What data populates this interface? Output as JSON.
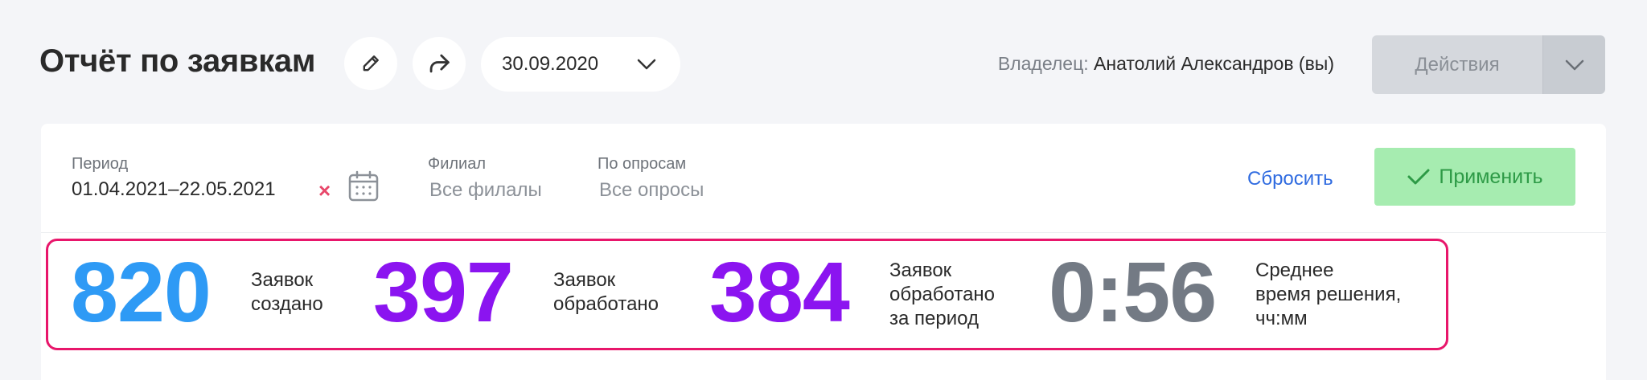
{
  "header": {
    "title": "Отчёт по заявкам",
    "date": "30.09.2020",
    "owner_label": "Владелец:",
    "owner_name": "Анатолий Александров (вы)",
    "actions_label": "Действия"
  },
  "filters": {
    "period_label": "Период",
    "period_value": "01.04.2021–22.05.2021",
    "clear_symbol": "×",
    "branch_label": "Филиал",
    "branch_value": "Все филалы",
    "survey_label": "По опросам",
    "survey_value": "Все опросы",
    "reset_label": "Сбросить",
    "apply_label": "Применить"
  },
  "stats": [
    {
      "value": "820",
      "label_line1": "Заявок",
      "label_line2": "создано",
      "label_line3": "",
      "color": "#2e9af5"
    },
    {
      "value": "397",
      "label_line1": "Заявок",
      "label_line2": "обработано",
      "label_line3": "",
      "color": "#8b14f0"
    },
    {
      "value": "384",
      "label_line1": "Заявок",
      "label_line2": "обработано",
      "label_line3": "за период",
      "color": "#8b14f0"
    },
    {
      "value": "0:56",
      "label_line1": "Среднее",
      "label_line2": "время решения,",
      "label_line3": "чч:мм",
      "color": "#737a84"
    }
  ],
  "colors": {
    "accent_link": "#2f6be0",
    "apply_bg": "#a6ecb0",
    "apply_text": "#2d9a46",
    "highlight_border": "#e8166b",
    "clear_x": "#e8476a"
  },
  "icons": {
    "edit": "pencil-icon",
    "share": "share-icon",
    "date_chevron": "chevron-down-icon",
    "actions_chevron": "chevron-down-icon",
    "clear": "close-icon",
    "calendar": "calendar-icon",
    "apply": "check-icon"
  }
}
